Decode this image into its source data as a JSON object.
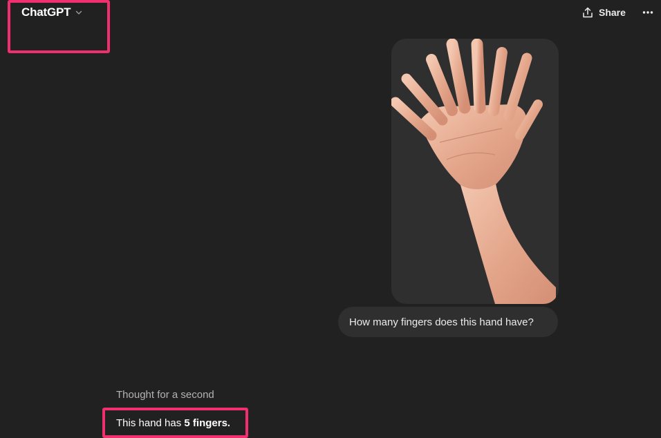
{
  "header": {
    "model_name": "ChatGPT",
    "model_icon": "chevron-down-icon",
    "share_label": "Share",
    "share_icon": "share-icon",
    "more_icon": "ellipsis-icon"
  },
  "conversation": {
    "user_image_icon": "hand-image",
    "user_message": "How many fingers does this hand have?",
    "thought_label": "Thought for a second",
    "answer_prefix": "This hand has ",
    "answer_bold": "5 fingers."
  },
  "colors": {
    "background": "#212121",
    "bubble": "#2f2f2f",
    "highlight": "#f0306e"
  }
}
